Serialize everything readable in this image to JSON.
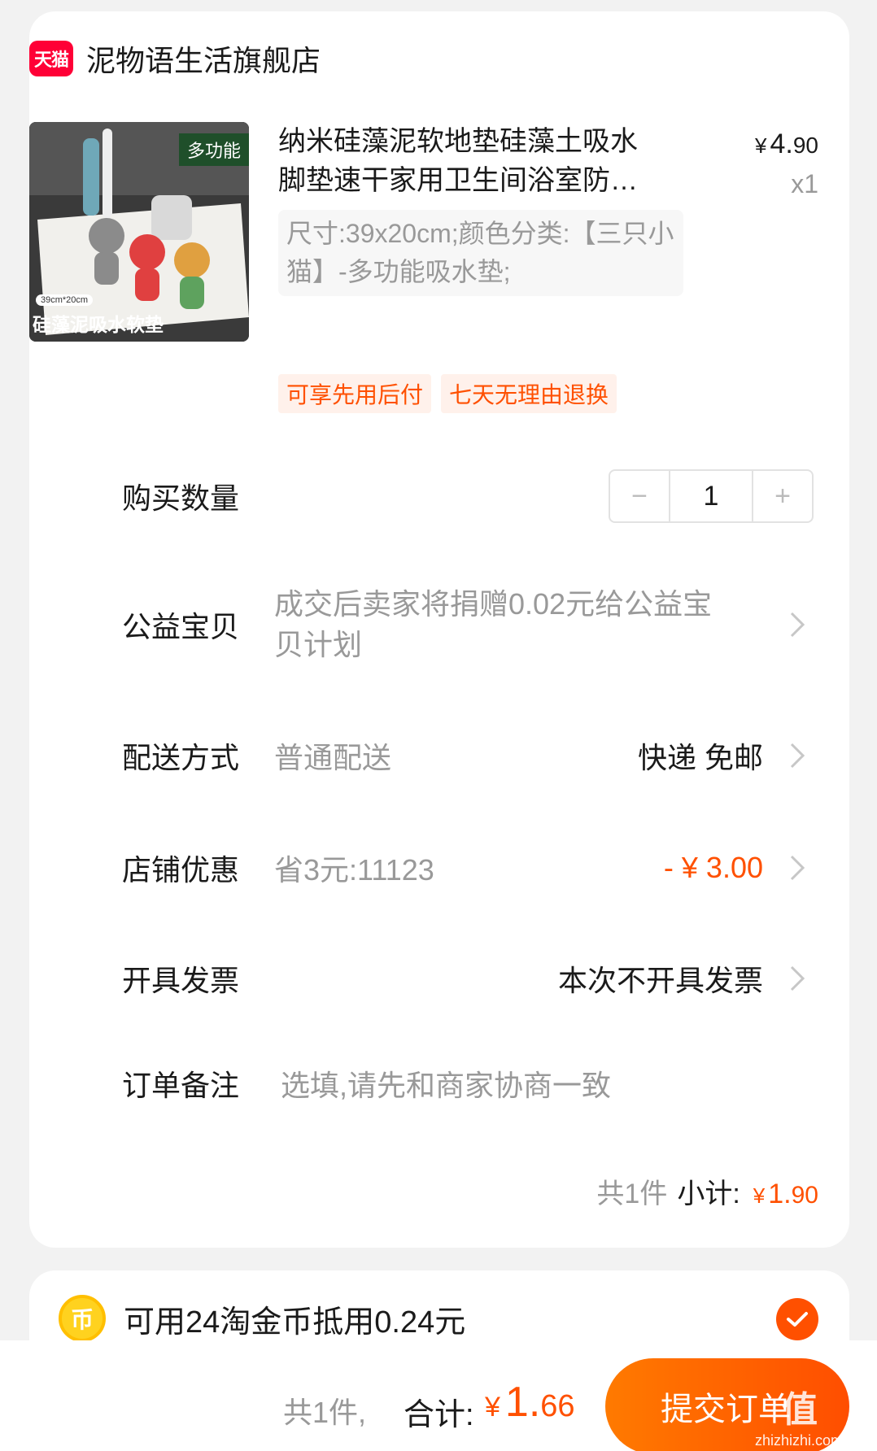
{
  "shop": {
    "badge": "天猫",
    "name": "泥物语生活旗舰店"
  },
  "product": {
    "thumb_tag": "多功能",
    "thumb_size": "39cm*20cm",
    "thumb_caption": "硅藻泥吸水软垫",
    "title": "纳米硅藻泥软地垫硅藻土吸水脚垫速干家用卫生间浴室防滑垫",
    "price_currency": "¥",
    "price_int": "4.",
    "price_dec": "90",
    "quantity_text": "x1",
    "spec": "尺寸:39x20cm;颜色分类:【三只小猫】-多功能吸水垫;",
    "badges": [
      "可享先用后付",
      "七天无理由退换"
    ]
  },
  "rows": {
    "quantity": {
      "label": "购买数量",
      "value": "1",
      "minus": "−",
      "plus": "+"
    },
    "charity": {
      "label": "公益宝贝",
      "value": "成交后卖家将捐赠0.02元给公益宝贝计划"
    },
    "delivery": {
      "label": "配送方式",
      "value": "普通配送",
      "right": "快递 免邮"
    },
    "discount": {
      "label": "店铺优惠",
      "value": "省3元:11123",
      "right": "- ¥ 3.00"
    },
    "invoice": {
      "label": "开具发票",
      "right": "本次不开具发票"
    },
    "note": {
      "label": "订单备注",
      "placeholder": "选填,请先和商家协商一致"
    }
  },
  "subtotal": {
    "count": "共1件",
    "label": "小计:",
    "currency": "¥",
    "int": "1.",
    "dec": "90"
  },
  "coins": {
    "icon_text": "币",
    "text": "可用24淘金币抵用0.24元",
    "checked": true
  },
  "footer": {
    "count": "共1件,",
    "label": "合计:",
    "currency": "¥",
    "int": "1.",
    "dec": "66",
    "submit": "提交订单"
  },
  "watermark": {
    "big": "值",
    "small": "zhizhizhi.com"
  },
  "colors": {
    "accent": "#ff5000",
    "tmall": "#ff0036",
    "coin": "#ffd21f"
  }
}
